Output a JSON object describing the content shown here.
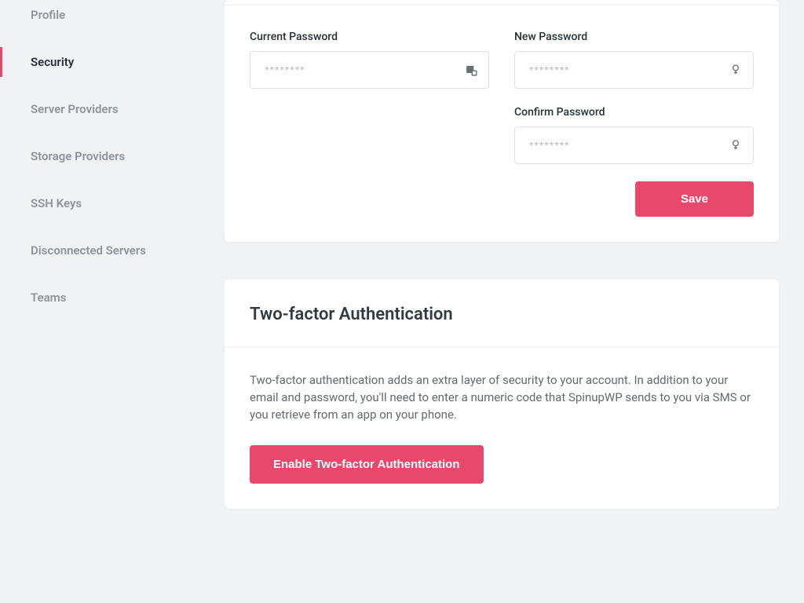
{
  "sidebar": {
    "items": [
      {
        "label": "Profile"
      },
      {
        "label": "Security"
      },
      {
        "label": "Server Providers"
      },
      {
        "label": "Storage Providers"
      },
      {
        "label": "SSH Keys"
      },
      {
        "label": "Disconnected Servers"
      },
      {
        "label": "Teams"
      }
    ],
    "activeIndex": 1
  },
  "password_card": {
    "current_label": "Current Password",
    "new_label": "New Password",
    "confirm_label": "Confirm Password",
    "placeholder": "********",
    "save_label": "Save"
  },
  "tfa_card": {
    "title": "Two-factor Authentication",
    "description": "Two-factor authentication adds an extra layer of security to your account. In addition to your email and password, you'll need to enter a numeric code that SpinupWP sends to you via SMS or you retrieve from an app on your phone.",
    "enable_label": "Enable Two-factor Authentication"
  }
}
